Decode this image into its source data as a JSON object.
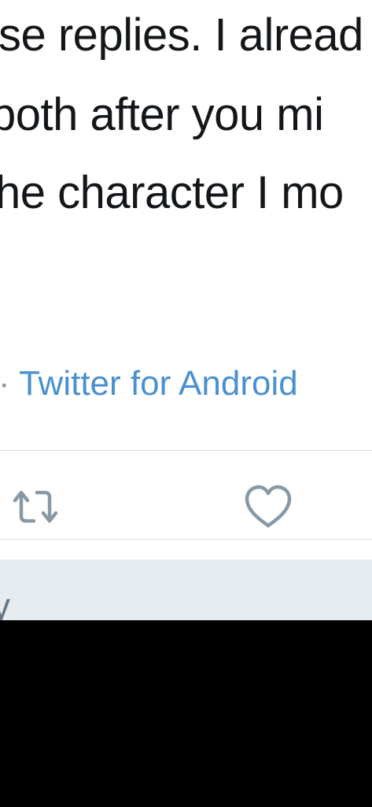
{
  "tweet": {
    "lines": [
      "se replies. I alread",
      "both after you mi",
      "he character I mo"
    ],
    "source_separator": "·",
    "source": "Twitter for Android"
  },
  "actions": {
    "retweet_icon": "retweet-icon",
    "like_icon": "heart-icon"
  },
  "reply_bar": {
    "text": "y"
  },
  "colors": {
    "text": "#14171a",
    "link": "#4a90d0",
    "icon": "#8899a6",
    "reply_bar_bg": "#e6ecf0"
  }
}
